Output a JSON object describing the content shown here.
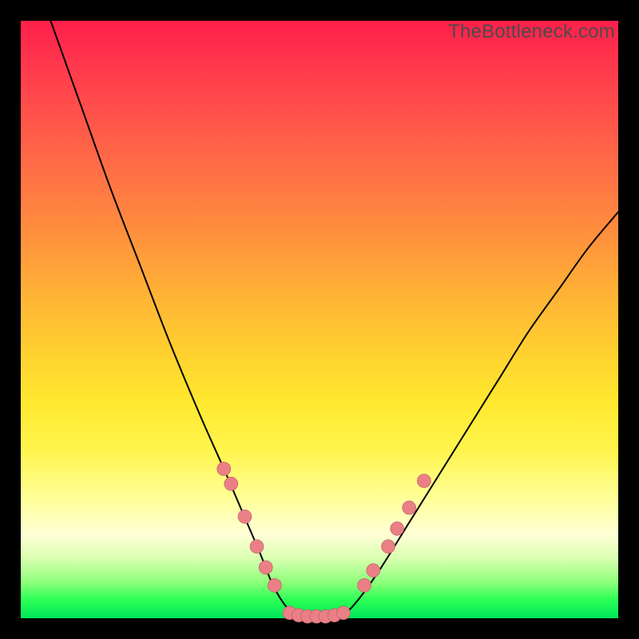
{
  "watermark": "TheBottleneck.com",
  "colors": {
    "frame": "#000000",
    "gradient_top": "#ff1f4a",
    "gradient_bottom": "#00e65a",
    "curve": "#000000",
    "dot_fill": "#ea7f86",
    "dot_stroke": "#b95a64"
  },
  "chart_data": {
    "type": "line",
    "title": "",
    "xlabel": "",
    "ylabel": "",
    "xlim": [
      0,
      100
    ],
    "ylim": [
      0,
      100
    ],
    "note": "V-shaped bottleneck curve; y≈0 is optimal (green), y≈100 is worst (red). x is a normalized hardware-balance axis.",
    "series": [
      {
        "name": "bottleneck-curve",
        "x": [
          5,
          10,
          15,
          20,
          25,
          30,
          34,
          37,
          40,
          42,
          44,
          46,
          48,
          50,
          52,
          54,
          56,
          60,
          65,
          70,
          75,
          80,
          85,
          90,
          95,
          100
        ],
        "y": [
          100,
          86,
          72,
          59,
          46,
          34,
          25,
          18,
          11,
          6,
          2.5,
          0.5,
          0,
          0,
          0,
          0.7,
          2.5,
          8,
          16,
          24,
          32,
          40,
          48,
          55,
          62,
          68
        ]
      }
    ],
    "markers": [
      {
        "name": "left-cluster",
        "x": 34.0,
        "y": 25.0
      },
      {
        "name": "left-cluster",
        "x": 35.2,
        "y": 22.5
      },
      {
        "name": "left-cluster",
        "x": 37.5,
        "y": 17.0
      },
      {
        "name": "left-cluster",
        "x": 39.5,
        "y": 12.0
      },
      {
        "name": "left-cluster",
        "x": 41.0,
        "y": 8.5
      },
      {
        "name": "left-cluster",
        "x": 42.5,
        "y": 5.5
      },
      {
        "name": "bottom-flat",
        "x": 45.0,
        "y": 0.9
      },
      {
        "name": "bottom-flat",
        "x": 46.5,
        "y": 0.5
      },
      {
        "name": "bottom-flat",
        "x": 48.0,
        "y": 0.3
      },
      {
        "name": "bottom-flat",
        "x": 49.5,
        "y": 0.3
      },
      {
        "name": "bottom-flat",
        "x": 51.0,
        "y": 0.3
      },
      {
        "name": "bottom-flat",
        "x": 52.5,
        "y": 0.5
      },
      {
        "name": "bottom-flat",
        "x": 54.0,
        "y": 0.9
      },
      {
        "name": "right-cluster",
        "x": 57.5,
        "y": 5.5
      },
      {
        "name": "right-cluster",
        "x": 59.0,
        "y": 8.0
      },
      {
        "name": "right-cluster",
        "x": 61.5,
        "y": 12.0
      },
      {
        "name": "right-cluster",
        "x": 63.0,
        "y": 15.0
      },
      {
        "name": "right-cluster",
        "x": 65.0,
        "y": 18.5
      },
      {
        "name": "right-cluster",
        "x": 67.5,
        "y": 23.0
      }
    ]
  }
}
